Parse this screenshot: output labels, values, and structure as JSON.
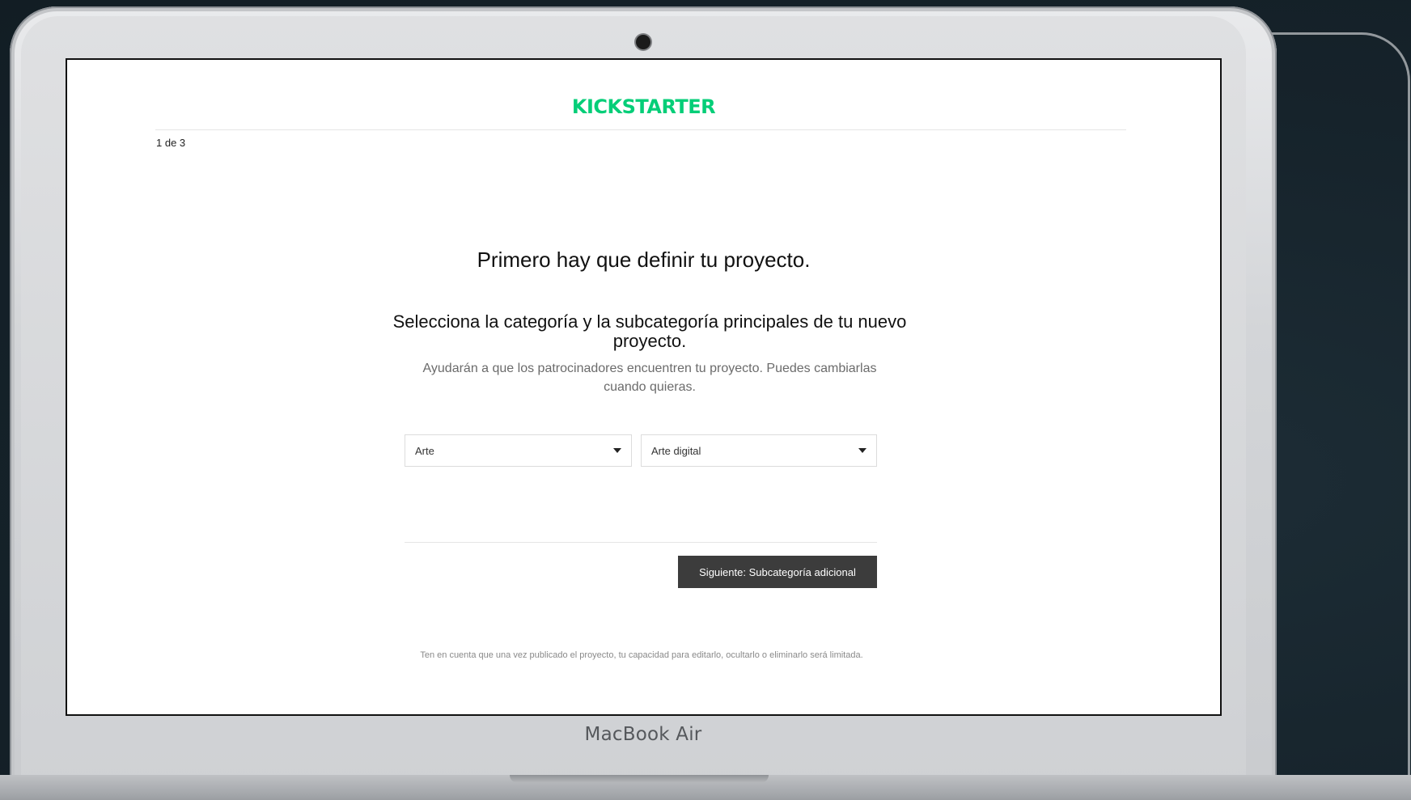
{
  "device": {
    "label": "MacBook Air"
  },
  "app": {
    "logo_text": "KICKSTARTER",
    "brand_color": "#05ce78"
  },
  "header": {
    "step_indicator": "1 de 3"
  },
  "main": {
    "title": "Primero hay que definir tu proyecto.",
    "section_heading": "Selecciona la categoría y la subcategoría principales de tu nuevo proyecto.",
    "section_help": "Ayudarán a que los patrocinadores encuentren tu proyecto. Puedes cambiarlas cuando quieras.",
    "category_select": {
      "value": "Arte",
      "icon": "caret-down-icon"
    },
    "subcategory_select": {
      "value": "Arte digital",
      "icon": "caret-down-icon"
    },
    "next_button_label": "Siguiente: Subcategoría adicional",
    "next_button_color": "#3c3c3c",
    "disclaimer": "Ten en cuenta que una vez publicado el proyecto, tu capacidad para editarlo, ocultarlo o eliminarlo será limitada."
  }
}
